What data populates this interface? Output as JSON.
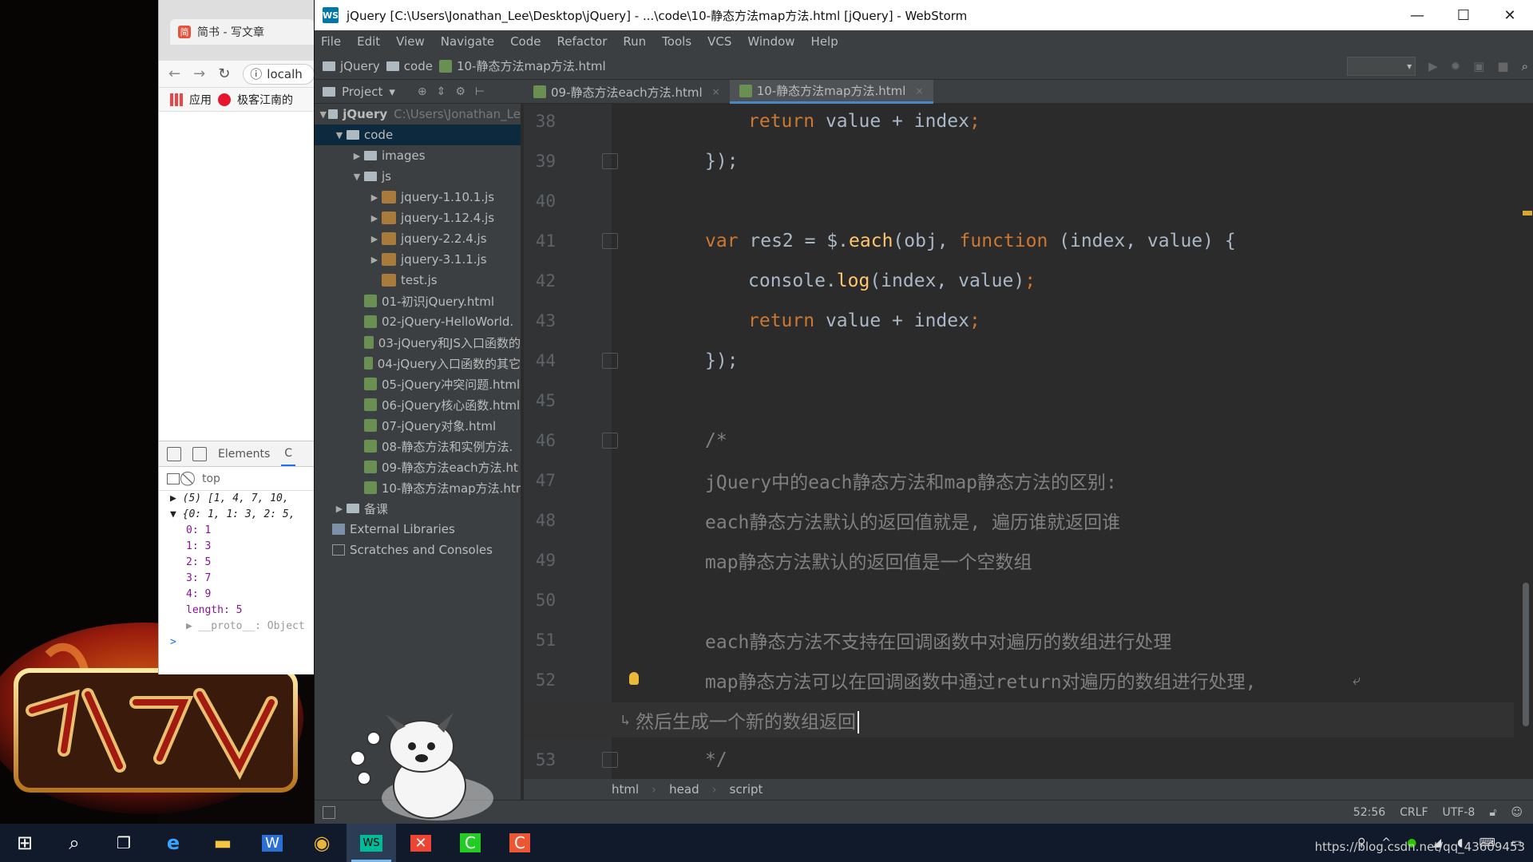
{
  "browser": {
    "tab_title": "简书 - 写文章",
    "tab_icon_glyph": "简",
    "url_fragment": "localh",
    "bookmarks": [
      "应用",
      "极客江南的"
    ],
    "devtools_tab_elements": "Elements",
    "devtools_tab_console_fragment": "C",
    "context": "top",
    "console_lines": [
      "▶ (5) [1, 4, 7, 10,",
      "▼ {0: 1, 1: 3, 2: 5,",
      "0: 1",
      "1: 3",
      "2: 5",
      "3: 7",
      "4: 9",
      "length: 5",
      "▶ __proto__: Object",
      ">"
    ]
  },
  "ide": {
    "title": "jQuery [C:\\Users\\Jonathan_Lee\\Desktop\\jQuery] - ...\\code\\10-静态方法map方法.html [jQuery] - WebStorm",
    "app_icon_glyph": "WS",
    "window_controls": {
      "minimize": "—",
      "maximize": "☐",
      "close": "✕"
    },
    "menu": [
      "File",
      "Edit",
      "View",
      "Navigate",
      "Code",
      "Refactor",
      "Run",
      "Tools",
      "VCS",
      "Window",
      "Help"
    ],
    "nav_crumbs": [
      "jQuery",
      "code",
      "10-静态方法map方法.html"
    ],
    "project_label": "Project",
    "project_dropdown_glyph": "▾",
    "tabs": [
      {
        "label": "09-静态方法each方法.html",
        "close": "×"
      },
      {
        "label": "10-静态方法map方法.html",
        "close": "×"
      }
    ],
    "tree": {
      "root": {
        "name": "jQuery",
        "path": "C:\\Users\\Jonathan_Le"
      },
      "code": "code",
      "images": "images",
      "js": "js",
      "js_files": [
        "jquery-1.10.1.js",
        "jquery-1.12.4.js",
        "jquery-2.2.4.js",
        "jquery-3.1.1.js",
        "test.js"
      ],
      "html_files": [
        "01-初识jQuery.html",
        "02-jQuery-HelloWorld.",
        "03-jQuery和JS入口函数的",
        "04-jQuery入口函数的其它",
        "05-jQuery冲突问题.html",
        "06-jQuery核心函数.html",
        "07-jQuery对象.html",
        "08-静态方法和实例方法.",
        "09-静态方法each方法.ht",
        "10-静态方法map方法.htr"
      ],
      "backup": "备课",
      "external": "External Libraries",
      "scratches": "Scratches and Consoles"
    },
    "code_lines": {
      "l38": {
        "n": "38",
        "a": "return",
        "b": " value + index",
        "c": ";"
      },
      "l39": {
        "n": "39",
        "a": "});"
      },
      "l40": {
        "n": "40"
      },
      "l41": {
        "n": "41",
        "a": "var",
        "b": " res2 = $.",
        "c": "each",
        "d": "(obj, ",
        "e": "function",
        "f": " (index, value) {"
      },
      "l42": {
        "n": "42",
        "a": "console.",
        "b": "log",
        "c": "(index, value)",
        "d": ";"
      },
      "l43": {
        "n": "43",
        "a": "return",
        "b": " value + index",
        "c": ";"
      },
      "l44": {
        "n": "44",
        "a": "});"
      },
      "l45": {
        "n": "45"
      },
      "l46": {
        "n": "46",
        "a": "/*"
      },
      "l47": {
        "n": "47",
        "a": "jQuery中的each静态方法和map静态方法的区别:"
      },
      "l48": {
        "n": "48",
        "a": "each静态方法默认的返回值就是, 遍历谁就返回谁"
      },
      "l49": {
        "n": "49",
        "a": "map静态方法默认的返回值是一个空数组"
      },
      "l50": {
        "n": "50"
      },
      "l51": {
        "n": "51",
        "a": "each静态方法不支持在回调函数中对遍历的数组进行处理"
      },
      "l52": {
        "n": "52",
        "a": "map静态方法可以在回调函数中通过return对遍历的数组进行处理,",
        "wrap": "⤶"
      },
      "l52b": {
        "a": "然后生成一个新的数组返回",
        "wrap": "↳"
      },
      "l53": {
        "n": "53",
        "a": "*/"
      }
    },
    "breadcrumb": [
      "html",
      "head",
      "script"
    ],
    "status": {
      "position": "52:56",
      "line_sep": "CRLF",
      "encoding": "UTF-8"
    }
  },
  "taskbar": {
    "start": "⊞",
    "search": "⌕",
    "task_view": "❐",
    "edge": "e",
    "explorer": "▬",
    "word": "W",
    "chrome": "◉",
    "webstorm": "WS",
    "xmind": "✕",
    "camtasia": "C",
    "recorder": "C",
    "tray_up": "^",
    "tray_person": "⚲"
  },
  "watermark": "https://blog.csdn.net/qq_43609453",
  "colors": {
    "keyword": "#cc7832",
    "function": "#ffc66d",
    "comment": "#808080",
    "text": "#a9b7c6",
    "editor_bg": "#2b2b2b"
  }
}
